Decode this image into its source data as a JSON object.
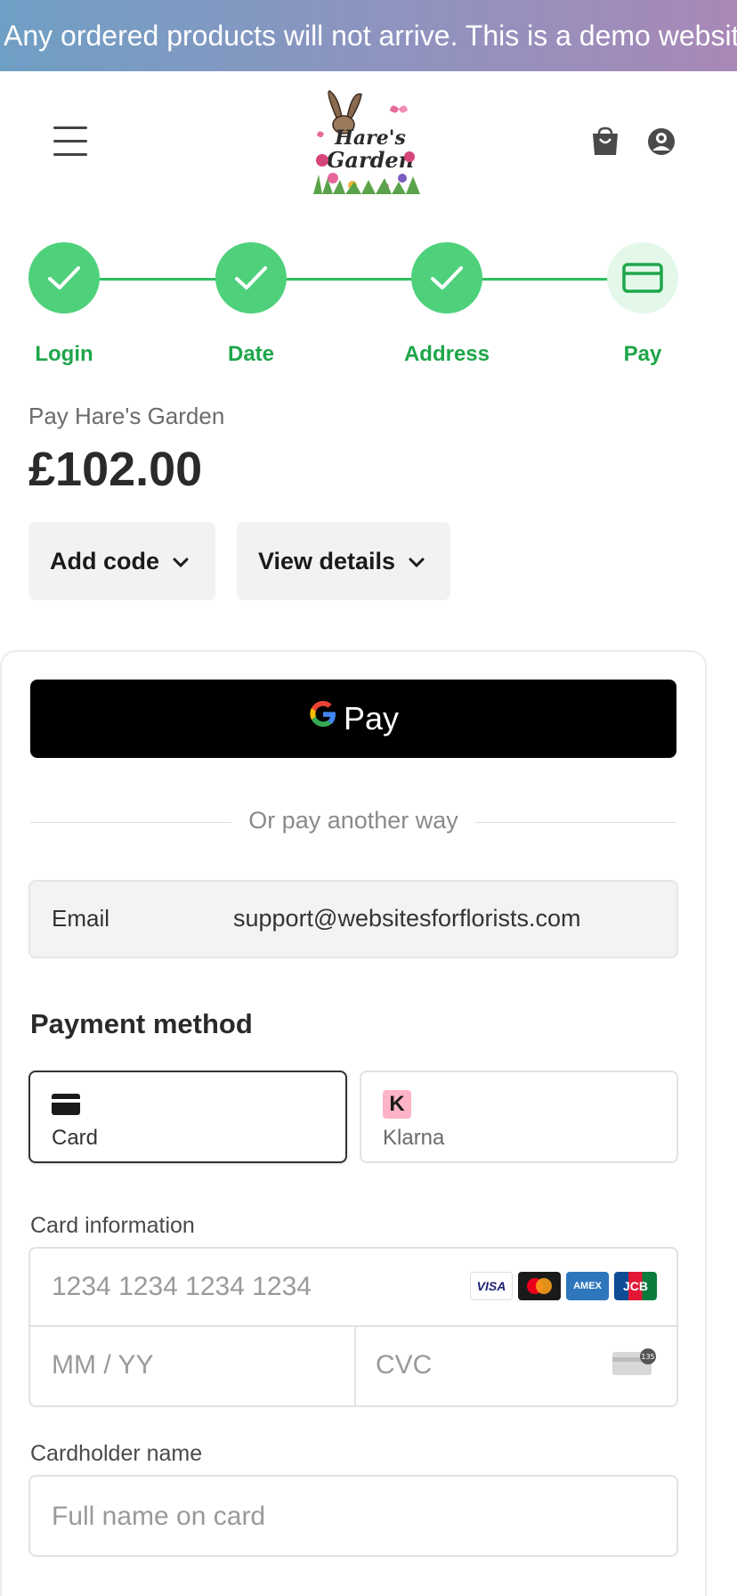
{
  "banner": {
    "text": "Any ordered products will not arrive. This is a demo website"
  },
  "header": {
    "logo_alt": "Hare's Garden",
    "icons": [
      "menu-icon",
      "cart-icon",
      "user-icon"
    ]
  },
  "steps": [
    {
      "label": "Login",
      "state": "done"
    },
    {
      "label": "Date",
      "state": "done"
    },
    {
      "label": "Address",
      "state": "done"
    },
    {
      "label": "Pay",
      "state": "current"
    }
  ],
  "checkout": {
    "pay_to": "Pay Hare's Garden",
    "amount": "£102.00",
    "add_code": "Add code",
    "view_details": "View details"
  },
  "payment": {
    "gpay_label": "Pay",
    "gpay_g": "G",
    "divider_text": "Or pay another way",
    "email_label": "Email",
    "email_value": "support@websitesforflorists.com",
    "method_title": "Payment method",
    "methods": [
      {
        "label": "Card",
        "selected": true
      },
      {
        "label": "Klarna",
        "selected": false,
        "badge": "K"
      }
    ],
    "card_info_label": "Card information",
    "card_number_placeholder": "1234 1234 1234 1234",
    "expiry_placeholder": "MM / YY",
    "cvc_placeholder": "CVC",
    "brands": [
      {
        "name": "VISA",
        "color": "#ffffff",
        "text_color": "#1a1f71"
      },
      {
        "name": "MC",
        "color": "#1a1a1a"
      },
      {
        "name": "AMEX",
        "color": "#2e77bc"
      },
      {
        "name": "JCB",
        "color": "#0b7c3e"
      }
    ],
    "cardholder_label": "Cardholder name",
    "cardholder_placeholder": "Full name on card"
  },
  "colors": {
    "step_green": "#4fd17c",
    "step_label_green": "#1ea64a",
    "banner_start": "#6f9fc4",
    "banner_end": "#a888b6"
  }
}
